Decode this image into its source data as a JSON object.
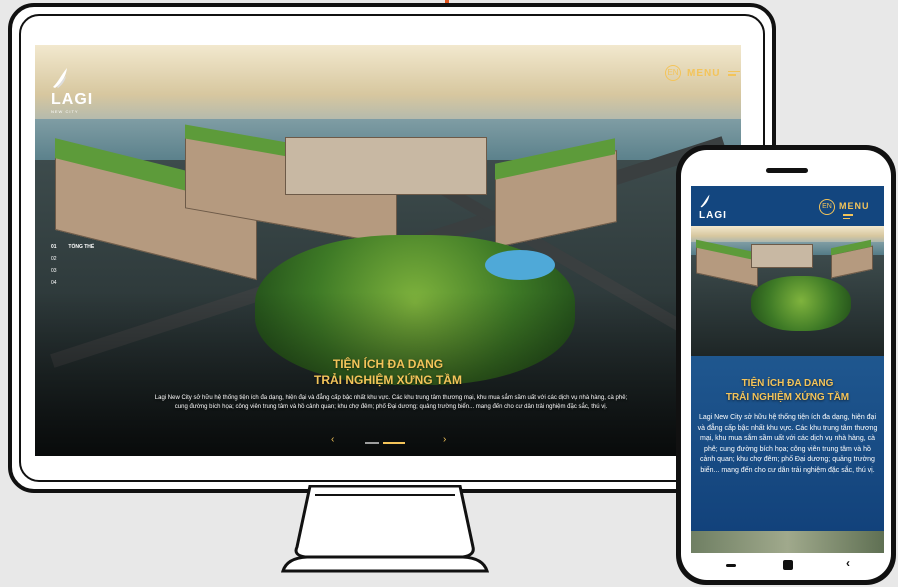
{
  "desktop": {
    "logo": {
      "text": "LAGI",
      "subtext": "NEW CITY"
    },
    "lang_label": "EN",
    "menu_label": "MENU",
    "side_nav": [
      {
        "num": "01",
        "label": "TỔNG THỂ",
        "active": true
      },
      {
        "num": "02",
        "label": ""
      },
      {
        "num": "03",
        "label": ""
      },
      {
        "num": "04",
        "label": ""
      }
    ],
    "title_line1": "TIỆN ÍCH ĐA DẠNG",
    "title_line2": "TRẢI NGHIỆM XỨNG TẦM",
    "body": "Lagi New City sở hữu hệ thống tiện ích đa dạng, hiện đại và đẳng cấp bậc nhất khu vực. Các khu trung tâm thương mại, khu mua sắm sầm uất với các dịch vụ nhà hàng, cà phê; cung đường bích họa; công viên trung tâm và hồ cảnh quan; khu chợ đêm; phố Đại dương; quảng trường biển... mang đến cho cư dân trải nghiệm đặc sắc, thú vị.",
    "prev_icon": "‹",
    "next_icon": "›",
    "slides_total": 2,
    "slide_active": 2
  },
  "phone": {
    "logo": {
      "text": "LAGI"
    },
    "lang_label": "EN",
    "menu_label": "MENU",
    "title_line1": "TIỆN ÍCH ĐA DANG",
    "title_line2": "TRẢI NGHIỆM XỨNG TẦM",
    "body": "Lagi New City sở hữu hệ thống tiện ích đa dạng, hiện đại và đẳng cấp bậc nhất khu vực. Các khu trung tâm thương mại, khu mua sắm sầm uất với các dịch vụ nhà hàng, cà phê; cung đường bích họa; công viên trung tâm và hồ cảnh quan; khu chợ đêm; phố Đại dương; quảng trường biển... mang đến cho cư dân trải nghiệm đặc sắc, thú vị."
  },
  "colors": {
    "accent": "#f3c45a",
    "phone_panel": "#12427b",
    "brand_orange": "#e1551f"
  },
  "icons": {
    "logo": "wing-logo-icon",
    "menu": "hamburger-menu-icon",
    "prev": "chevron-left-icon",
    "next": "chevron-right-icon"
  }
}
